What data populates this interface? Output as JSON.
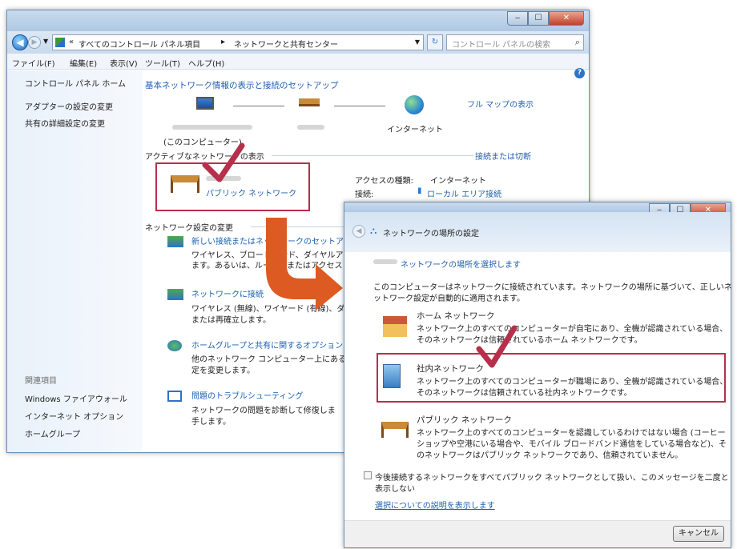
{
  "back_window": {
    "address_path": [
      "すべてのコントロール パネル項目",
      "ネットワークと共有センター"
    ],
    "address_prefix": "«",
    "search_placeholder": "コントロール パネルの検索",
    "menu": [
      "ファイル(F)",
      "編集(E)",
      "表示(V)",
      "ツール(T)",
      "ヘルプ(H)"
    ],
    "sidebar": {
      "top": [
        "コントロール パネル ホーム",
        "アダプターの設定の変更",
        "共有の詳細設定の変更"
      ],
      "related_heading": "関連項目",
      "related": [
        "Windows ファイアウォール",
        "インターネット オプション",
        "ホームグループ"
      ]
    },
    "main": {
      "heading": "基本ネットワーク情報の表示と接続のセットアップ",
      "full_map": "フル マップの表示",
      "this_computer": "(このコンピューター)",
      "internet": "インターネット",
      "active_heading": "アクティブなネットワークの表示",
      "connect_disconnect": "接続または切断",
      "public_network": "パブリック ネットワーク",
      "access_type_label": "アクセスの種類:",
      "access_type_value": "インターネット",
      "connection_label": "接続:",
      "connection_value": "ローカル エリア接続",
      "change_heading": "ネットワーク設定の変更",
      "tasks": [
        {
          "title": "新しい接続またはネットワークのセットア",
          "desc": [
            "ワイヤレス、ブロードバンド、ダイヤルア",
            "ます。あるいは、ルーターまたはアクセス"
          ]
        },
        {
          "title": "ネットワークに接続",
          "desc": [
            "ワイヤレス (無線)、ワイヤード (有線)、ダ",
            "または再確立します。"
          ]
        },
        {
          "title": "ホームグループと共有に関するオプション",
          "desc": [
            "他のネットワーク コンピューター上にある",
            "定を変更します。"
          ]
        },
        {
          "title": "問題のトラブルシューティング",
          "desc": [
            "ネットワークの問題を診断して修復しま",
            "手します。"
          ]
        }
      ]
    }
  },
  "front_window": {
    "title": "ネットワークの場所の設定",
    "select_heading": "ネットワークの場所を選択します",
    "intro": [
      "このコンピューターはネットワークに接続されています。ネットワークの場所に基づいて、正しいネ",
      "ットワーク設定が自動的に適用されます。"
    ],
    "options": [
      {
        "title": "ホーム ネットワーク",
        "desc": [
          "ネットワーク上のすべてのコンピューターが自宅にあり、全機が認識されている場合、",
          "そのネットワークは信頼されているホーム ネットワークです。"
        ]
      },
      {
        "title": "社内ネットワーク",
        "desc": [
          "ネットワーク上のすべてのコンピューターが職場にあり、全機が認識されている場合、",
          "そのネットワークは信頼されている社内ネットワークです。"
        ]
      },
      {
        "title": "パブリック ネットワーク",
        "desc": [
          "ネットワーク上のすべてのコンピューターを認識しているわけではない場合 (コーヒー",
          "ショップや空港にいる場合や、モバイル ブロードバンド通信をしている場合など)、そ",
          "のネットワークはパブリック ネットワークであり、信頼されていません。"
        ]
      }
    ],
    "checkbox_label": [
      "今後接続するネットワークをすべてパブリック ネットワークとして扱い、このメッセージを二度と",
      "表示しない"
    ],
    "explain_link": "選択についての説明を表示します",
    "cancel": "キャンセル"
  },
  "colors": {
    "accent_red": "#b62f4b",
    "arrow_orange": "#dd5a22",
    "link_blue": "#1c5fb0"
  }
}
